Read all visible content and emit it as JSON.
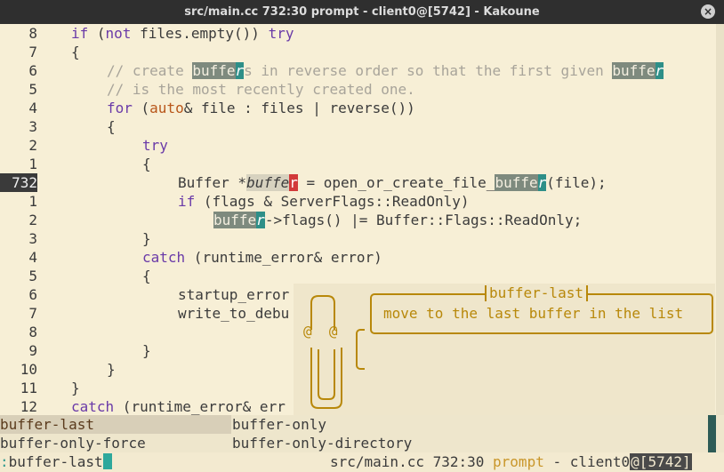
{
  "window": {
    "title": "src/main.cc 732:30  prompt - client0@[5742] - Kakoune",
    "close_glyph": "×"
  },
  "editor": {
    "lines": [
      {
        "num": "8",
        "segments": [
          [
            "kw",
            "if"
          ],
          [
            "",
            " ("
          ],
          [
            "kw",
            "not"
          ],
          [
            "",
            " files.empty()) "
          ],
          [
            "kw",
            "try"
          ]
        ],
        "indent": 0
      },
      {
        "num": "7",
        "segments": [
          [
            "",
            "{"
          ]
        ],
        "indent": 0
      },
      {
        "num": "6",
        "segments": [
          [
            "cm",
            "// create "
          ],
          [
            "hl",
            "buffe"
          ],
          [
            "hlc",
            "r"
          ],
          [
            "cm",
            "s in reverse order so that the first given "
          ],
          [
            "hl",
            "buffe"
          ],
          [
            "hlc",
            "r"
          ]
        ],
        "indent": 4
      },
      {
        "num": "5",
        "segments": [
          [
            "cm",
            "// is the most recently created one."
          ]
        ],
        "indent": 4
      },
      {
        "num": "4",
        "segments": [
          [
            "kw",
            "for"
          ],
          [
            "",
            " ("
          ],
          [
            "ty",
            "auto"
          ],
          [
            "",
            "& file : files | reverse())"
          ]
        ],
        "indent": 4
      },
      {
        "num": "3",
        "segments": [
          [
            "",
            "{"
          ]
        ],
        "indent": 4
      },
      {
        "num": "2",
        "segments": [
          [
            "kw",
            "try"
          ]
        ],
        "indent": 8
      },
      {
        "num": "1",
        "segments": [
          [
            "",
            "{"
          ]
        ],
        "indent": 8
      },
      {
        "num": "732",
        "current": true,
        "segments": [
          [
            "",
            "Buffer *"
          ],
          [
            "sel",
            "buffe"
          ],
          [
            "cur-red",
            "r"
          ],
          [
            "",
            " = open_or_create_file_"
          ],
          [
            "hl",
            "buffe"
          ],
          [
            "hlc",
            "r"
          ],
          [
            "",
            "(file);"
          ]
        ],
        "indent": 12
      },
      {
        "num": "1",
        "segments": [
          [
            "kw",
            "if"
          ],
          [
            "",
            " (flags & ServerFlags::ReadOnly)"
          ]
        ],
        "indent": 12
      },
      {
        "num": "2",
        "segments": [
          [
            "hl",
            "buffe"
          ],
          [
            "hlc",
            "r"
          ],
          [
            "",
            "->flags() |= Buffer::Flags::ReadOnly;"
          ]
        ],
        "indent": 16
      },
      {
        "num": "3",
        "segments": [
          [
            "",
            "}"
          ]
        ],
        "indent": 8
      },
      {
        "num": "4",
        "segments": [
          [
            "kw",
            "catch"
          ],
          [
            "",
            " (runtime_error& error)"
          ]
        ],
        "indent": 8
      },
      {
        "num": "5",
        "segments": [
          [
            "",
            "{"
          ]
        ],
        "indent": 8
      },
      {
        "num": "6",
        "segments": [
          [
            "",
            "startup_error"
          ]
        ],
        "indent": 12
      },
      {
        "num": "7",
        "segments": [
          [
            "",
            "write_to_debu"
          ]
        ],
        "indent": 12
      },
      {
        "num": "8",
        "segments": [
          [
            "",
            ""
          ]
        ],
        "indent": 12
      },
      {
        "num": "9",
        "segments": [
          [
            "",
            "}"
          ]
        ],
        "indent": 8
      },
      {
        "num": "10",
        "segments": [
          [
            "",
            "}"
          ]
        ],
        "indent": 4
      },
      {
        "num": "11",
        "segments": [
          [
            "",
            "}"
          ]
        ],
        "indent": 0
      },
      {
        "num": "12",
        "segments": [
          [
            "kw",
            "catch"
          ],
          [
            "",
            " (runtime_error& err"
          ]
        ],
        "indent": 0
      }
    ]
  },
  "info": {
    "title": "buffer-last",
    "body": "move to the last buffer in the list",
    "clippy_eyes": "@  @"
  },
  "menu": {
    "items": [
      {
        "label": "buffer-last",
        "selected": true
      },
      {
        "label": "buffer-only",
        "selected": false
      },
      {
        "label": "buffer-only-force",
        "selected": false
      },
      {
        "label": "buffer-only-directory",
        "selected": false
      }
    ]
  },
  "status": {
    "prompt_colon": ":",
    "prompt_text": "buffer-last",
    "file_pos": "src/main.cc 732:30 ",
    "mode": "prompt",
    "dash": " - ",
    "client": "client0",
    "session": "@[5742]"
  },
  "colors": {
    "background": "#f7efd6",
    "keyword": "#6a3aa8",
    "info_accent": "#b8880a",
    "cursor": "#d23a3a",
    "selection_teal": "#2e8f88"
  }
}
